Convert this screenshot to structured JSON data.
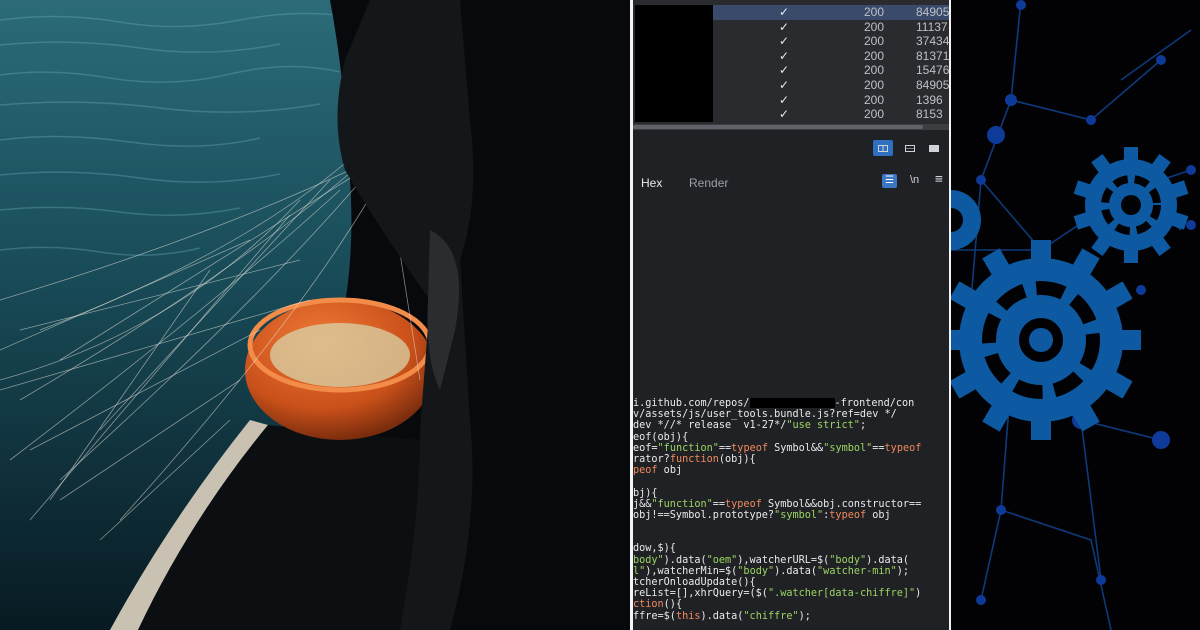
{
  "network_table": {
    "rows": [
      {
        "check": "✓",
        "status": "200",
        "size": "84905",
        "selected": true
      },
      {
        "check": "✓",
        "status": "200",
        "size": "11137",
        "selected": false
      },
      {
        "check": "✓",
        "status": "200",
        "size": "37434",
        "selected": false
      },
      {
        "check": "✓",
        "status": "200",
        "size": "81371",
        "selected": false
      },
      {
        "check": "✓",
        "status": "200",
        "size": "15476",
        "selected": false
      },
      {
        "check": "✓",
        "status": "200",
        "size": "84905",
        "selected": false
      },
      {
        "check": "✓",
        "status": "200",
        "size": "1396",
        "selected": false
      },
      {
        "check": "✓",
        "status": "200",
        "size": "8153",
        "selected": false
      }
    ]
  },
  "response_panel": {
    "tabs": [
      {
        "label": "Hex",
        "active": true
      },
      {
        "label": "Render",
        "active": false
      }
    ],
    "wrap_label": "☰",
    "newline_label": "\\n",
    "menu_label": "≡"
  },
  "code_lines": [
    [
      {
        "t": "i.github.com/repos/",
        "c": "plain"
      },
      {
        "t": "",
        "c": "redact"
      },
      {
        "t": "-frontend/con",
        "c": "plain"
      }
    ],
    [
      {
        "t": "v/assets/js/user_tools.bundle.js?ref=dev */",
        "c": "plain"
      }
    ],
    [
      {
        "t": "dev *//* release  v1-27*/",
        "c": "plain"
      },
      {
        "t": "\"use strict\"",
        "c": "str"
      },
      {
        "t": ";",
        "c": "plain"
      }
    ],
    [
      {
        "t": "eof(obj){",
        "c": "plain"
      }
    ],
    [
      {
        "t": "eof=",
        "c": "plain"
      },
      {
        "t": "\"function\"",
        "c": "str"
      },
      {
        "t": "==",
        "c": "plain"
      },
      {
        "t": "typeof",
        "c": "kw"
      },
      {
        "t": " Symbol&&",
        "c": "plain"
      },
      {
        "t": "\"symbol\"",
        "c": "str"
      },
      {
        "t": "==",
        "c": "plain"
      },
      {
        "t": "typeof",
        "c": "kw"
      }
    ],
    [
      {
        "t": "rator?",
        "c": "plain"
      },
      {
        "t": "function",
        "c": "kw"
      },
      {
        "t": "(obj){",
        "c": "plain"
      }
    ],
    [
      {
        "t": "peof",
        "c": "kw"
      },
      {
        "t": " obj",
        "c": "plain"
      }
    ],
    [],
    [
      {
        "t": "bj){",
        "c": "plain"
      }
    ],
    [
      {
        "t": "j&&",
        "c": "plain"
      },
      {
        "t": "\"function\"",
        "c": "str"
      },
      {
        "t": "==",
        "c": "plain"
      },
      {
        "t": "typeof",
        "c": "kw"
      },
      {
        "t": " Symbol&&obj.constructor==",
        "c": "plain"
      }
    ],
    [
      {
        "t": "obj!==Symbol.prototype?",
        "c": "plain"
      },
      {
        "t": "\"symbol\"",
        "c": "str"
      },
      {
        "t": ":",
        "c": "plain"
      },
      {
        "t": "typeof",
        "c": "kw"
      },
      {
        "t": " obj",
        "c": "plain"
      }
    ],
    [],
    [],
    [
      {
        "t": "dow,$){",
        "c": "plain"
      }
    ],
    [
      {
        "t": "body\"",
        "c": "str"
      },
      {
        "t": ").data(",
        "c": "plain"
      },
      {
        "t": "\"oem\"",
        "c": "str"
      },
      {
        "t": "),watcherURL=$(",
        "c": "plain"
      },
      {
        "t": "\"body\"",
        "c": "str"
      },
      {
        "t": ").data(",
        "c": "plain"
      }
    ],
    [
      {
        "t": "l\"",
        "c": "str"
      },
      {
        "t": "),watcherMin=$(",
        "c": "plain"
      },
      {
        "t": "\"body\"",
        "c": "str"
      },
      {
        "t": ").data(",
        "c": "plain"
      },
      {
        "t": "\"watcher-min\"",
        "c": "str"
      },
      {
        "t": ");",
        "c": "plain"
      }
    ],
    [
      {
        "t": "tcherOnloadUpdate(){",
        "c": "plain"
      }
    ],
    [
      {
        "t": "reList=[],xhrQuery=($(",
        "c": "plain"
      },
      {
        "t": "\".watcher[data-chiffre]\"",
        "c": "str"
      },
      {
        "t": ")",
        "c": "plain"
      }
    ],
    [
      {
        "t": "ction",
        "c": "kw"
      },
      {
        "t": "(){",
        "c": "plain"
      }
    ],
    [
      {
        "t": "ffre=$(",
        "c": "plain"
      },
      {
        "t": "this",
        "c": "kw"
      },
      {
        "t": ").data(",
        "c": "plain"
      },
      {
        "t": "\"chiffre\"",
        "c": "str"
      },
      {
        "t": ");",
        "c": "plain"
      }
    ]
  ],
  "colors": {
    "devtools_bg": "#202124",
    "selected_row": "#3a4a6b",
    "accent_blue": "#2f6fbf",
    "code_keyword": "#f08a5d",
    "code_string": "#9bd565",
    "gear_blue": "#0d5aa3",
    "basket_orange": "#d2551c",
    "sea_teal": "#3f7f8c"
  },
  "icons": [
    "checkmark-icon",
    "split-vertical-icon",
    "split-horizontal-icon",
    "single-pane-icon",
    "wrap-lines-icon",
    "newline-toggle-icon",
    "menu-icon",
    "gear-icon"
  ]
}
